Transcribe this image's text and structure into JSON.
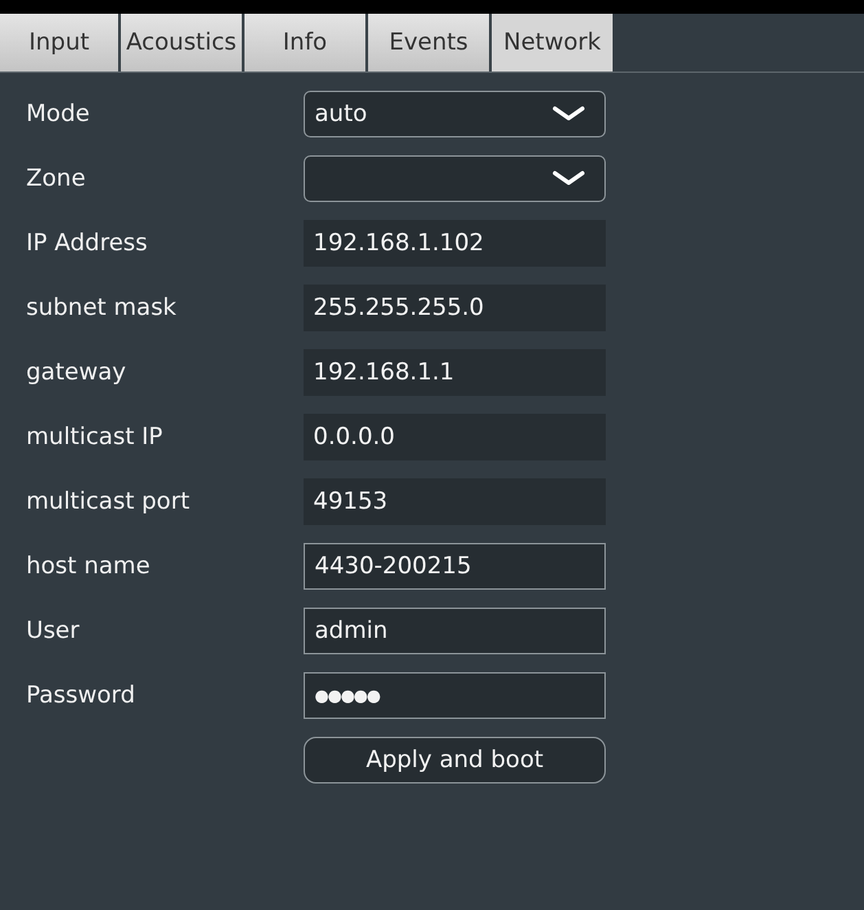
{
  "tabs": [
    {
      "label": "Input",
      "selected": false
    },
    {
      "label": "Acoustics",
      "selected": false
    },
    {
      "label": "Info",
      "selected": false
    },
    {
      "label": "Events",
      "selected": false
    },
    {
      "label": "Network",
      "selected": true
    }
  ],
  "fields": [
    {
      "label": "Mode",
      "kind": "select",
      "value": "auto"
    },
    {
      "label": "Zone",
      "kind": "select"
    },
    {
      "label": "IP Address",
      "kind": "readonly",
      "value": "192.168.1.102"
    },
    {
      "label": "subnet mask",
      "kind": "readonly",
      "value": "255.255.255.0"
    },
    {
      "label": "gateway",
      "kind": "readonly",
      "value": "192.168.1.1"
    },
    {
      "label": "multicast IP",
      "kind": "readonly",
      "value": "0.0.0.0"
    },
    {
      "label": "multicast port",
      "kind": "readonly",
      "value": "49153"
    },
    {
      "label": "host name",
      "kind": "text",
      "value": "4430-200215"
    },
    {
      "label": "User",
      "kind": "text",
      "value": "admin"
    },
    {
      "label": "Password",
      "kind": "password",
      "value": "●●●●●"
    }
  ],
  "apply_button": "Apply and boot"
}
